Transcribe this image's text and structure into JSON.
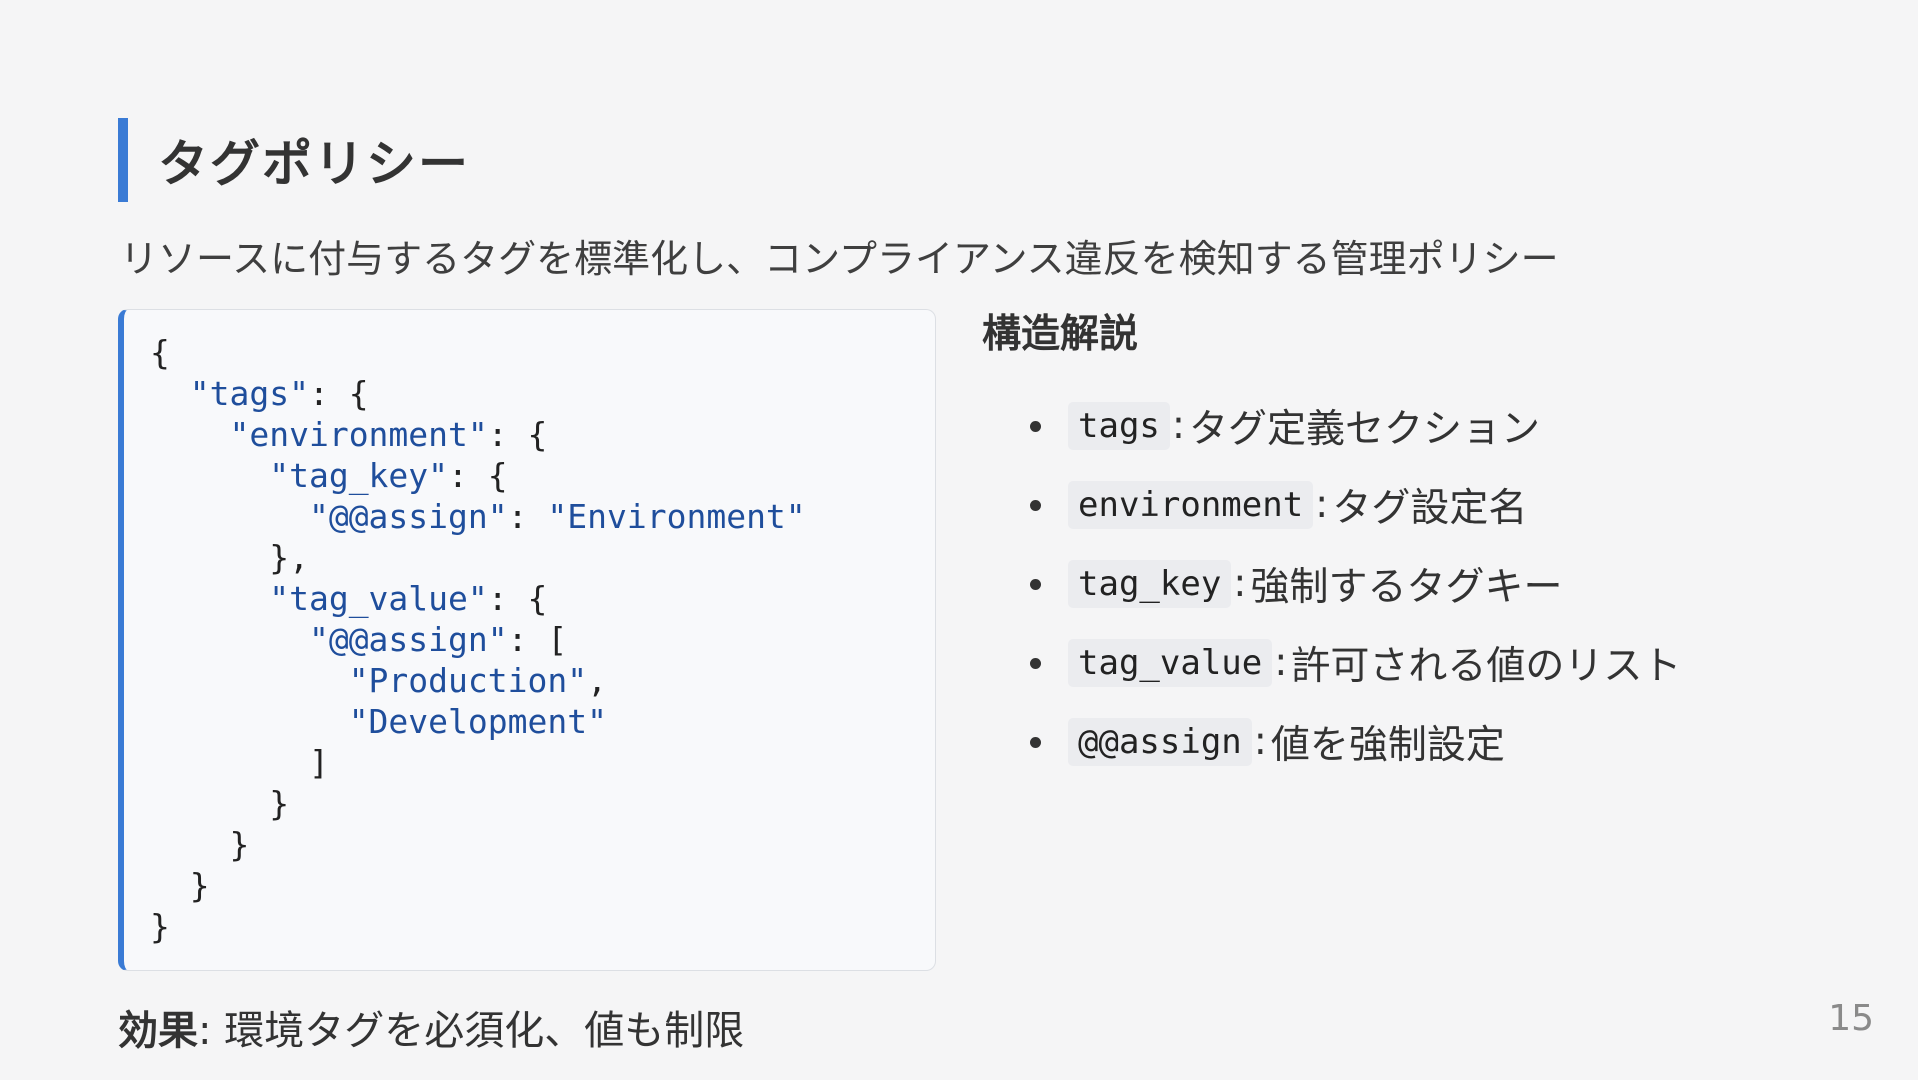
{
  "slide": {
    "title": "タグポリシー",
    "subtitle": "リソースに付与するタグを標準化し、コンプライアンス違反を検知する管理ポリシー",
    "page_number": "15"
  },
  "code": {
    "lines": [
      [
        "{"
      ],
      [
        "  ",
        {
          "s": "\"tags\""
        },
        ": {"
      ],
      [
        "    ",
        {
          "s": "\"environment\""
        },
        ": {"
      ],
      [
        "      ",
        {
          "s": "\"tag_key\""
        },
        ": {"
      ],
      [
        "        ",
        {
          "s": "\"@@assign\""
        },
        ": ",
        {
          "s": "\"Environment\""
        }
      ],
      [
        "      },"
      ],
      [
        "      ",
        {
          "s": "\"tag_value\""
        },
        ": {"
      ],
      [
        "        ",
        {
          "s": "\"@@assign\""
        },
        ": ["
      ],
      [
        "          ",
        {
          "s": "\"Production\""
        },
        ","
      ],
      [
        "          ",
        {
          "s": "\"Development\""
        }
      ],
      [
        "        ]"
      ],
      [
        "      }"
      ],
      [
        "    }"
      ],
      [
        "  }"
      ],
      [
        "}"
      ]
    ]
  },
  "explanation": {
    "heading": "構造解説",
    "items": [
      {
        "code": "tags",
        "text": "タグ定義セクション"
      },
      {
        "code": "environment",
        "text": "タグ設定名"
      },
      {
        "code": "tag_key",
        "text": "強制するタグキー"
      },
      {
        "code": "tag_value",
        "text": "許可される値のリスト"
      },
      {
        "code": "@@assign",
        "text": "値を強制設定"
      }
    ]
  },
  "footer": {
    "label": "効果",
    "text": "環境タグを必須化、値も制限"
  }
}
